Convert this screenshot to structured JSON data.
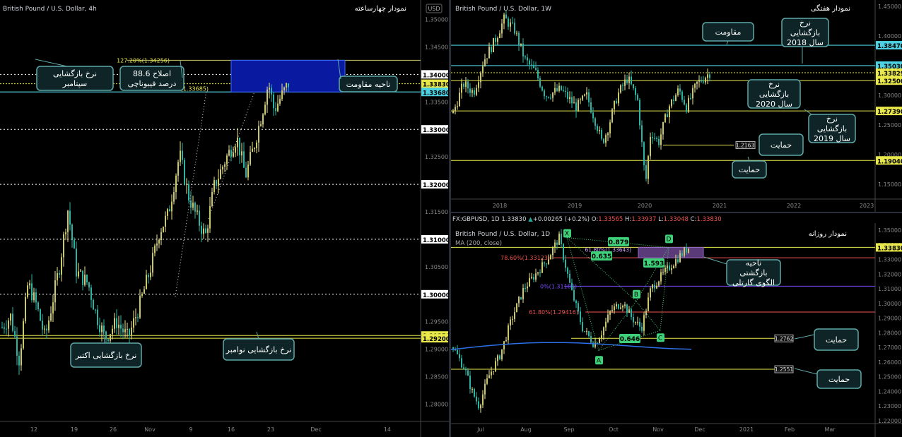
{
  "colors": {
    "up": "#26a69a",
    "down": "#26a69a",
    "wickUp": "#f0e68c",
    "yellow": "#e8e84a",
    "cyan": "#4dd0e1",
    "grid": "#333",
    "calloutFill": "#0e2426",
    "calloutStroke": "#5fa8a8",
    "pattern": "#3fd07a",
    "ma": "#2f6fe8",
    "box": "#0a1aa0",
    "prz": "#5b3a7a"
  },
  "left": {
    "title": "British Pound / U.S. Dollar, 4h",
    "label": "نمودار چهارساعته",
    "currency": "USD",
    "yaxis": {
      "min": 1.2775,
      "max": 1.3525
    },
    "ticks": [
      "1.35000",
      "1.34500",
      "1.34000",
      "1.33500",
      "1.33000",
      "1.32500",
      "1.32000",
      "1.31500",
      "1.31000",
      "1.30500",
      "1.30000",
      "1.29500",
      "1.29000",
      "1.28500",
      "1.28000"
    ],
    "tick_values": [
      1.35,
      1.345,
      1.34,
      1.335,
      1.33,
      1.325,
      1.32,
      1.315,
      1.31,
      1.305,
      1.3,
      1.295,
      1.29,
      1.285,
      1.28
    ],
    "xlabels": [
      "12",
      "19",
      "26",
      "Nov",
      "9",
      "16",
      "23",
      "Dec",
      "14"
    ],
    "price_tags": [
      {
        "text": "1.34000",
        "value": 1.34,
        "style": "white"
      },
      {
        "text": "1.33830",
        "value": 1.3383,
        "style": "yellow"
      },
      {
        "text": "1.33680",
        "value": 1.3368,
        "style": "cyan"
      },
      {
        "text": "1.33000",
        "value": 1.33,
        "style": "white"
      },
      {
        "text": "1.32000",
        "value": 1.32,
        "style": "white"
      },
      {
        "text": "1.31000",
        "value": 1.31,
        "style": "white"
      },
      {
        "text": "1.30000",
        "value": 1.3,
        "style": "white"
      },
      {
        "text": "1.29250",
        "value": 1.2925,
        "style": "yellow"
      },
      {
        "text": "1.29200",
        "value": 1.292,
        "style": "yellow"
      }
    ],
    "fib_top": "127.20%(1.34256)",
    "fib_bottom": "127.20%(1.33685)",
    "callouts": {
      "sep_open": "نرخ بازگشایی سپتامبر",
      "fib": "اصلاح 88.6 درصد فیبوناچی",
      "resistance_zone": "ناحیه مقاومت",
      "oct_open": "نرخ بازگشایی اکتبر",
      "nov_open": "نرخ بازگشایی نوامبر"
    }
  },
  "right_top": {
    "title": "British Pound / U.S. Dollar, 1W",
    "label": "نمودار هفتگی",
    "ticks": [
      "1.45000",
      "1.40000",
      "1.35000",
      "1.30000",
      "1.25000",
      "1.20000",
      "1.15000"
    ],
    "tick_values": [
      1.45,
      1.4,
      1.35,
      1.3,
      1.25,
      1.2,
      1.15
    ],
    "yaxis": {
      "min": 1.13,
      "max": 1.455
    },
    "xlabels": [
      "2018",
      "2019",
      "2020",
      "2021",
      "2022",
      "2023"
    ],
    "price_tags": [
      {
        "text": "1.38470",
        "value": 1.3847,
        "style": "cyan"
      },
      {
        "text": "1.35030",
        "value": 1.3503,
        "style": "cyan"
      },
      {
        "text": "1.33829",
        "value": 1.33829,
        "style": "yellow"
      },
      {
        "text": "1.32500",
        "value": 1.325,
        "style": "yellow"
      },
      {
        "text": "1.27390",
        "value": 1.2739,
        "style": "yellow"
      },
      {
        "text": "1.19040",
        "value": 1.1904,
        "style": "yellow"
      }
    ],
    "small_tag": "1.2163",
    "callouts": {
      "resistance": "مقاومت",
      "open2018": "نرخ بازگشایی سال 2018",
      "open2020": "نرخ بازگشایی سال 2020",
      "open2019": "نرخ بازگشایی سال 2019",
      "support1": "حمایت",
      "support2": "حمایت"
    }
  },
  "right_bottom": {
    "header": {
      "symbol": "FX:GBPUSD, 1D",
      "price": "1.33830",
      "change": "+0.00265 (+0.2%)",
      "o_label": "O:",
      "o": "1.33565",
      "h_label": "H:",
      "h": "1.33937",
      "l_label": "L:",
      "l": "1.33048",
      "c_label": "C:",
      "c": "1.33830"
    },
    "title": "British Pound / U.S. Dollar, 1D",
    "ma_label": "MA (200, close)",
    "label": "نمودار روزانه",
    "ticks": [
      "1.35000",
      "1.34000",
      "1.33000",
      "1.32000",
      "1.31000",
      "1.30000",
      "1.29000",
      "1.28000",
      "1.27000",
      "1.26000",
      "1.25000",
      "1.24000",
      "1.23000",
      "1.22000"
    ],
    "tick_values": [
      1.35,
      1.34,
      1.33,
      1.32,
      1.31,
      1.3,
      1.29,
      1.28,
      1.27,
      1.26,
      1.25,
      1.24,
      1.23,
      1.22
    ],
    "yaxis": {
      "min": 1.218,
      "max": 1.352
    },
    "xlabels": [
      "Jul",
      "Aug",
      "Sep",
      "Oct",
      "Nov",
      "Dec",
      "2021",
      "Feb",
      "Mar"
    ],
    "price_tag": {
      "text": "1.33830",
      "value": 1.3383
    },
    "fib_786": "78.60%(1.33123)",
    "fib_618_top": "61.80%(1.33643)",
    "fib_618_bottom": "61.80%(1.29416)",
    "fib_mid": "0%(1.31180)",
    "ratios": {
      "r1": "0.879",
      "r2": "0.635",
      "r3": "1.593",
      "r4": "0.646"
    },
    "points": {
      "x": "X",
      "a": "A",
      "b": "B",
      "c": "C",
      "d": "D"
    },
    "small_tags": [
      "1.2762",
      "1.2551"
    ],
    "callouts": {
      "gartley": "ناحیه بازگشتی الگوی گارتلی",
      "support1": "حمایت",
      "support2": "حمایت"
    }
  }
}
